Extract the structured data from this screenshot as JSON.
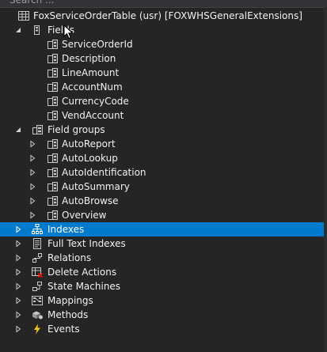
{
  "search": {
    "placeholder": "Search ..."
  },
  "tree": {
    "root_label": "FoxServiceOrderTable (usr) [FOXWHSGeneralExtensions]",
    "fields": {
      "label": "Fields",
      "items": [
        "ServiceOrderId",
        "Description",
        "LineAmount",
        "AccountNum",
        "CurrencyCode",
        "VendAccount"
      ]
    },
    "field_groups": {
      "label": "Field groups",
      "items": [
        "AutoReport",
        "AutoLookup",
        "AutoIdentification",
        "AutoSummary",
        "AutoBrowse",
        "Overview"
      ]
    },
    "sections": [
      "Indexes",
      "Full Text Indexes",
      "Relations",
      "Delete Actions",
      "State Machines",
      "Mappings",
      "Methods",
      "Events"
    ],
    "selected": "Indexes"
  },
  "colors": {
    "selection": "#007acc",
    "background": "#252526",
    "text": "#f1f1f1"
  },
  "icons": {
    "root": "table-icon",
    "fields": "fields-folder-icon",
    "field": "field-icon",
    "field_groups": "field-groups-icon",
    "field_group": "field-group-icon",
    "sections": [
      "indexes-icon",
      "full-text-indexes-icon",
      "relations-icon",
      "delete-actions-icon",
      "state-machines-icon",
      "mappings-icon",
      "methods-icon",
      "events-icon"
    ]
  }
}
